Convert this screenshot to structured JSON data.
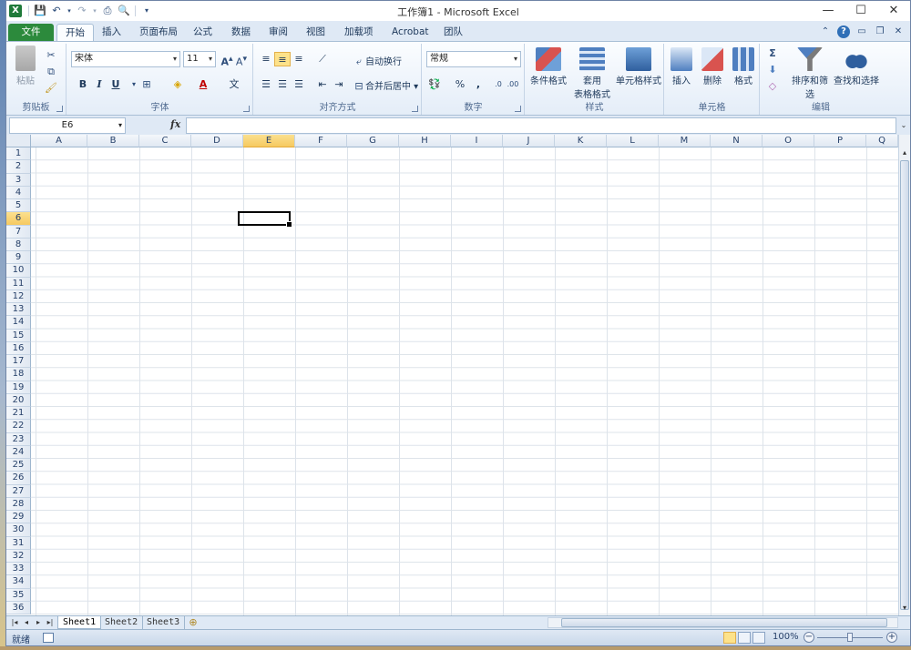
{
  "window": {
    "title": "工作簿1 - Microsoft Excel",
    "logo": "X"
  },
  "qat": {
    "icons": [
      "save-icon",
      "undo-icon",
      "redo-icon",
      "quick-print-icon",
      "print-preview-icon",
      "customize-icon"
    ]
  },
  "window_controls": {
    "minimize": "—",
    "maximize": "☐",
    "close": "✕"
  },
  "tabs": [
    {
      "label": "文件"
    },
    {
      "label": "开始"
    },
    {
      "label": "插入"
    },
    {
      "label": "页面布局"
    },
    {
      "label": "公式"
    },
    {
      "label": "数据"
    },
    {
      "label": "审阅"
    },
    {
      "label": "视图"
    },
    {
      "label": "加载项"
    },
    {
      "label": "Acrobat"
    },
    {
      "label": "团队"
    }
  ],
  "ribbon": {
    "clipboard": {
      "label": "剪贴板",
      "paste": "粘贴"
    },
    "font": {
      "label": "字体",
      "font_name": "宋体",
      "font_size": "11",
      "bold": "B",
      "italic": "I",
      "underline": "U",
      "font_color_letter": "A",
      "wen": "文"
    },
    "alignment": {
      "label": "对齐方式",
      "wrap": "自动换行",
      "merge": "合并后居中"
    },
    "number": {
      "label": "数字",
      "format": "常规",
      "percent": "%",
      "comma": ","
    },
    "styles": {
      "label": "样式",
      "conditional": "条件格式",
      "table_line1": "套用",
      "table_line2": "表格格式",
      "cell_styles": "单元格样式"
    },
    "cells": {
      "label": "单元格",
      "insert": "插入",
      "delete": "删除",
      "format": "格式"
    },
    "editing": {
      "label": "编辑",
      "sort": "排序和筛选",
      "find": "查找和选择",
      "sigma": "Σ"
    }
  },
  "formula_bar": {
    "name_box": "E6",
    "fx": "fx",
    "value": ""
  },
  "columns": [
    "A",
    "B",
    "C",
    "D",
    "E",
    "F",
    "G",
    "H",
    "I",
    "J",
    "K",
    "L",
    "M",
    "N",
    "O",
    "P",
    "Q"
  ],
  "rows": [
    "1",
    "2",
    "3",
    "4",
    "5",
    "6",
    "7",
    "8",
    "9",
    "10",
    "11",
    "12",
    "13",
    "14",
    "15",
    "16",
    "17",
    "18",
    "19",
    "20",
    "21",
    "22",
    "23",
    "24",
    "25",
    "26",
    "27",
    "28",
    "29",
    "30",
    "31",
    "32",
    "33",
    "34",
    "35",
    "36"
  ],
  "selection": {
    "column": "E",
    "row": "6"
  },
  "sheets": [
    {
      "name": "Sheet1"
    },
    {
      "name": "Sheet2"
    },
    {
      "name": "Sheet3"
    }
  ],
  "status": {
    "ready": "就绪",
    "zoom": "100%"
  },
  "colors": {
    "file_tab": "#2c8a3c",
    "selection_header": "#f6c960"
  }
}
